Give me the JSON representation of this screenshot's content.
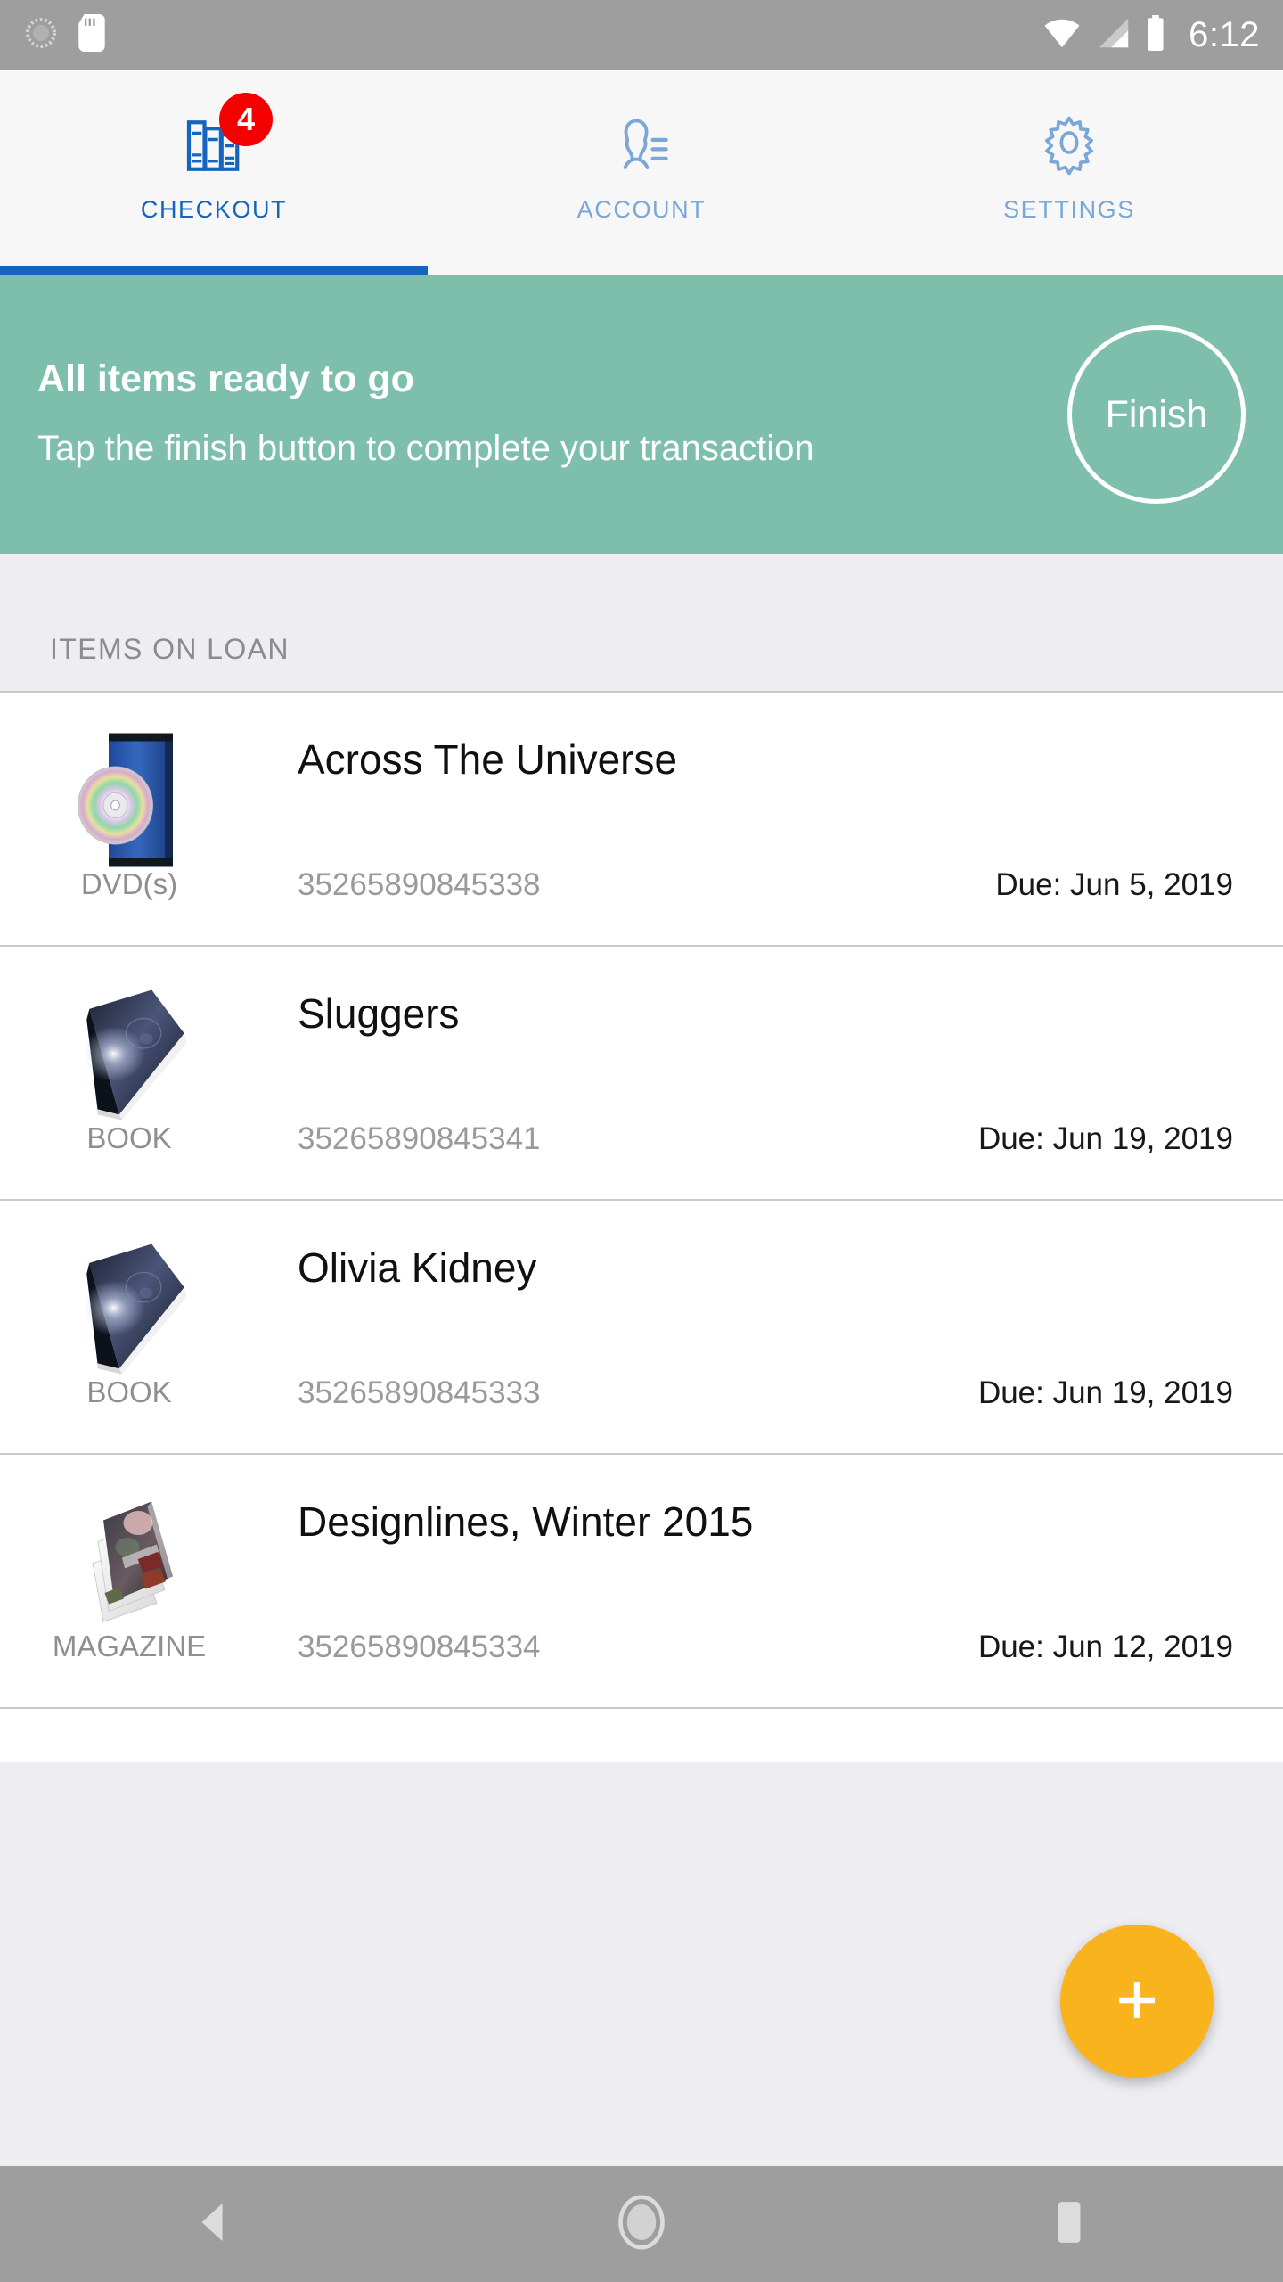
{
  "statusbar": {
    "time": "6:12",
    "icons": [
      "sync-spinner-icon",
      "sd-card-icon",
      "wifi-icon",
      "cellular-signal-icon",
      "battery-icon"
    ]
  },
  "tabs": [
    {
      "label": "CHECKOUT",
      "icon": "books-icon",
      "badge": "4",
      "active": true
    },
    {
      "label": "ACCOUNT",
      "icon": "account-person-icon",
      "badge": "",
      "active": false
    },
    {
      "label": "SETTINGS",
      "icon": "gear-icon",
      "badge": "",
      "active": false
    }
  ],
  "banner": {
    "title": "All items ready to go",
    "subtitle": "Tap the finish button to complete your transaction",
    "button_label": "Finish",
    "background_color": "#7dbfab"
  },
  "section": {
    "title": "ITEMS ON LOAN"
  },
  "items": [
    {
      "title": "Across The Universe",
      "type": "DVD(s)",
      "barcode": "35265890845338",
      "due": "Due: Jun 5, 2019",
      "thumb": "dvd-case-icon"
    },
    {
      "title": "Sluggers",
      "type": "BOOK",
      "barcode": "35265890845341",
      "due": "Due: Jun 19, 2019",
      "thumb": "book-cover-icon"
    },
    {
      "title": "Olivia Kidney",
      "type": "BOOK",
      "barcode": "35265890845333",
      "due": "Due: Jun 19, 2019",
      "thumb": "book-cover-icon"
    },
    {
      "title": "Designlines, Winter 2015",
      "type": "MAGAZINE",
      "barcode": "35265890845334",
      "due": "Due: Jun 12, 2019",
      "thumb": "magazine-icon"
    }
  ],
  "fab": {
    "icon": "plus-icon",
    "color": "#f9b41d"
  },
  "navbar": {
    "back": "back-triangle-icon",
    "home": "home-circle-icon",
    "recents": "recents-square-icon"
  },
  "colors": {
    "accent_blue": "#1565c0",
    "badge_red": "#f50000",
    "banner_green": "#7dbfab",
    "fab_amber": "#f9b41d"
  }
}
